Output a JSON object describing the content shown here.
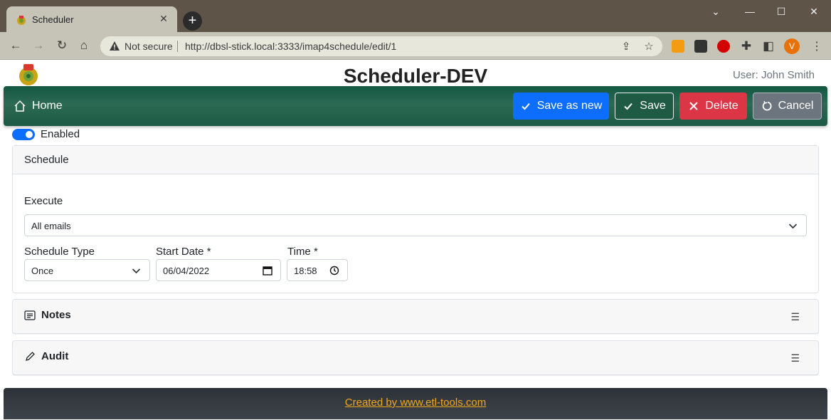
{
  "browser": {
    "tab_title": "Scheduler",
    "tab_close": "✕",
    "new_tab": "+",
    "not_secure": "Not secure",
    "url": "http://dbsl-stick.local:3333/imap4schedule/edit/1",
    "profile_initial": "V",
    "window_controls": {
      "minimize": "—",
      "maximize": "☐",
      "close": "✕",
      "tabsearch": "⌄"
    }
  },
  "header": {
    "title": "Scheduler-DEV",
    "user": "User: John Smith"
  },
  "appbar": {
    "home": "Home",
    "save_as_new": "Save as new",
    "save": "Save",
    "delete": "Delete",
    "cancel": "Cancel"
  },
  "form": {
    "enabled_label": "Enabled",
    "enabled": true,
    "schedule_header": "Schedule",
    "execute_label": "Execute",
    "execute_value": "All emails",
    "schedule_type_label": "Schedule Type",
    "schedule_type_value": "Once",
    "start_date_label": "Start Date *",
    "start_date_value": "06/04/2022",
    "time_label": "Time *",
    "time_value": "18:58"
  },
  "sections": {
    "notes": "Notes",
    "audit": "Audit",
    "menu_glyph": "☰"
  },
  "footer": {
    "link": "Created by www.etl-tools.com"
  },
  "colors": {
    "appbar": "#1f5a44",
    "primary": "#0d6efd",
    "danger": "#dc3545",
    "secondary": "#6c757d",
    "footer_link": "#f0a81c"
  }
}
